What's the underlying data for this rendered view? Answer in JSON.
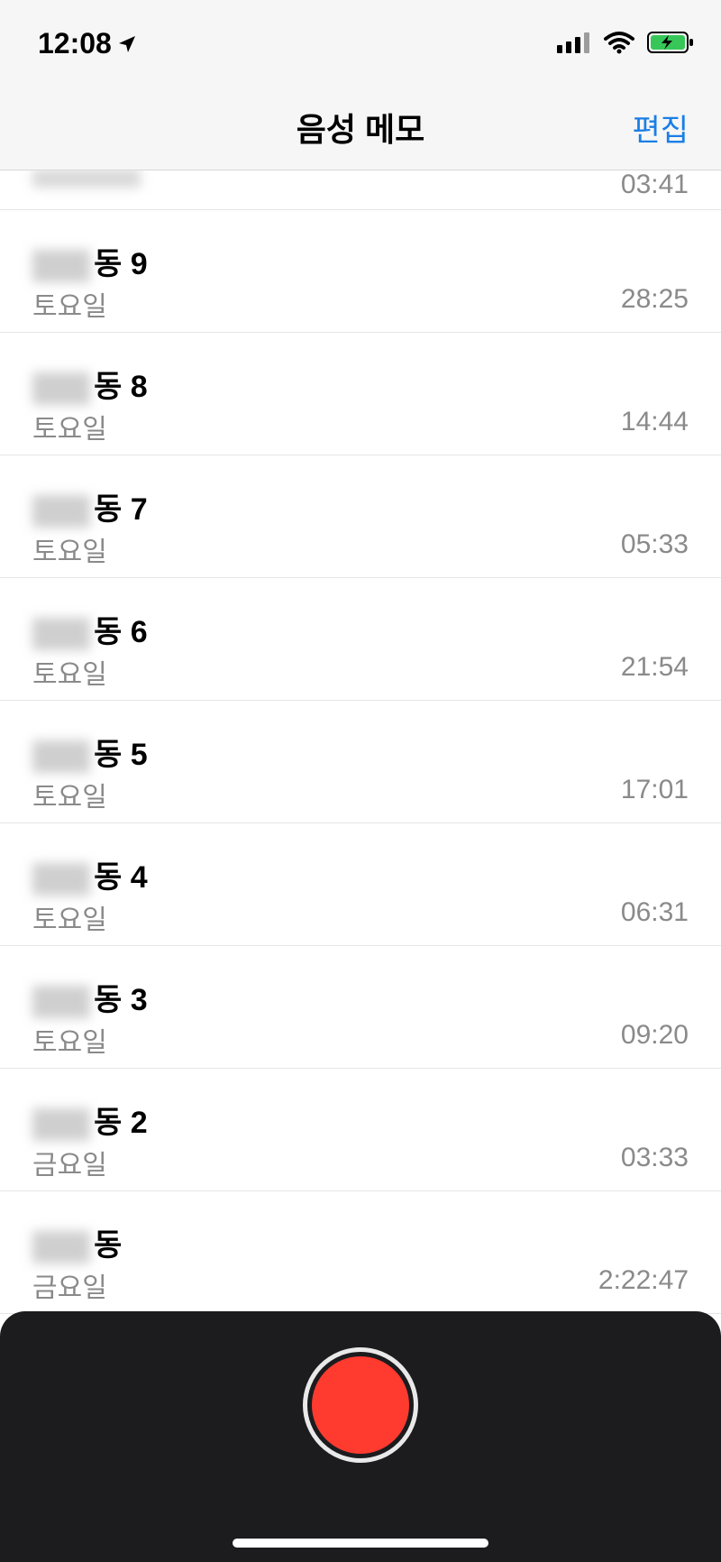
{
  "status": {
    "time": "12:08"
  },
  "nav": {
    "title": "음성 메모",
    "edit": "편집"
  },
  "list": {
    "partial_top_duration": "03:41",
    "items": [
      {
        "title": "동 9",
        "subtitle": "토요일",
        "duration": "28:25"
      },
      {
        "title": "동 8",
        "subtitle": "토요일",
        "duration": "14:44"
      },
      {
        "title": "동 7",
        "subtitle": "토요일",
        "duration": "05:33"
      },
      {
        "title": "동 6",
        "subtitle": "토요일",
        "duration": "21:54"
      },
      {
        "title": "동 5",
        "subtitle": "토요일",
        "duration": "17:01"
      },
      {
        "title": "동 4",
        "subtitle": "토요일",
        "duration": "06:31"
      },
      {
        "title": "동 3",
        "subtitle": "토요일",
        "duration": "09:20"
      },
      {
        "title": "동 2",
        "subtitle": "금요일",
        "duration": "03:33"
      },
      {
        "title": "동",
        "subtitle": "금요일",
        "duration": "2:22:47"
      }
    ]
  },
  "colors": {
    "accent": "#1a7ee6",
    "record": "#ff3b30",
    "panel": "#1c1c1e"
  }
}
